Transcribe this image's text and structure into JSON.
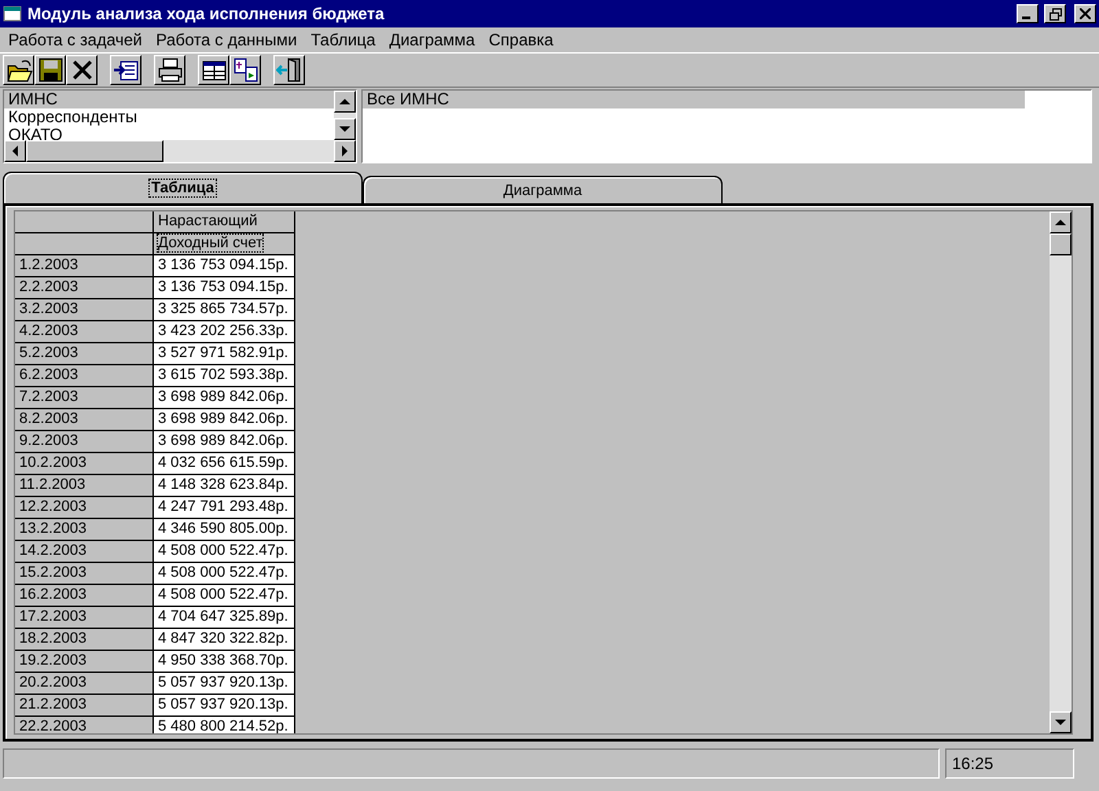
{
  "window": {
    "title": "Модуль анализа хода исполнения бюджета"
  },
  "menu": [
    "Работа с задачей",
    "Работа с данными",
    "Таблица",
    "Диаграмма",
    "Справка"
  ],
  "left_list": {
    "items": [
      {
        "label": "ИМНС",
        "selected": true
      },
      {
        "label": "Корреспонденты",
        "selected": false
      },
      {
        "label": "ОКАТО",
        "selected": false
      }
    ]
  },
  "right_list": {
    "items": [
      {
        "label": "Все ИМНС",
        "selected": true
      }
    ]
  },
  "tabs": [
    {
      "label": "Таблица",
      "selected": true
    },
    {
      "label": "Диаграмма",
      "selected": false
    }
  ],
  "table": {
    "group_header": "Нарастающий",
    "column_header": "Доходный счет",
    "rows": [
      {
        "date": "1.2.2003",
        "value": "3 136 753 094.15р."
      },
      {
        "date": "2.2.2003",
        "value": "3 136 753 094.15р."
      },
      {
        "date": "3.2.2003",
        "value": "3 325 865 734.57р."
      },
      {
        "date": "4.2.2003",
        "value": "3 423 202 256.33р."
      },
      {
        "date": "5.2.2003",
        "value": "3 527 971 582.91р."
      },
      {
        "date": "6.2.2003",
        "value": "3 615 702 593.38р."
      },
      {
        "date": "7.2.2003",
        "value": "3 698 989 842.06р."
      },
      {
        "date": "8.2.2003",
        "value": "3 698 989 842.06р."
      },
      {
        "date": "9.2.2003",
        "value": "3 698 989 842.06р."
      },
      {
        "date": "10.2.2003",
        "value": "4 032 656 615.59р."
      },
      {
        "date": "11.2.2003",
        "value": "4 148 328 623.84р."
      },
      {
        "date": "12.2.2003",
        "value": "4 247 791 293.48р."
      },
      {
        "date": "13.2.2003",
        "value": "4 346 590 805.00р."
      },
      {
        "date": "14.2.2003",
        "value": "4 508 000 522.47р."
      },
      {
        "date": "15.2.2003",
        "value": "4 508 000 522.47р."
      },
      {
        "date": "16.2.2003",
        "value": "4 508 000 522.47р."
      },
      {
        "date": "17.2.2003",
        "value": "4 704 647 325.89р."
      },
      {
        "date": "18.2.2003",
        "value": "4 847 320 322.82р."
      },
      {
        "date": "19.2.2003",
        "value": "4 950 338 368.70р."
      },
      {
        "date": "20.2.2003",
        "value": "5 057 937 920.13р."
      },
      {
        "date": "21.2.2003",
        "value": "5 057 937 920.13р."
      },
      {
        "date": "22.2.2003",
        "value": "5 480 800 214.52р."
      }
    ]
  },
  "status_bar": {
    "time": "16:25"
  }
}
